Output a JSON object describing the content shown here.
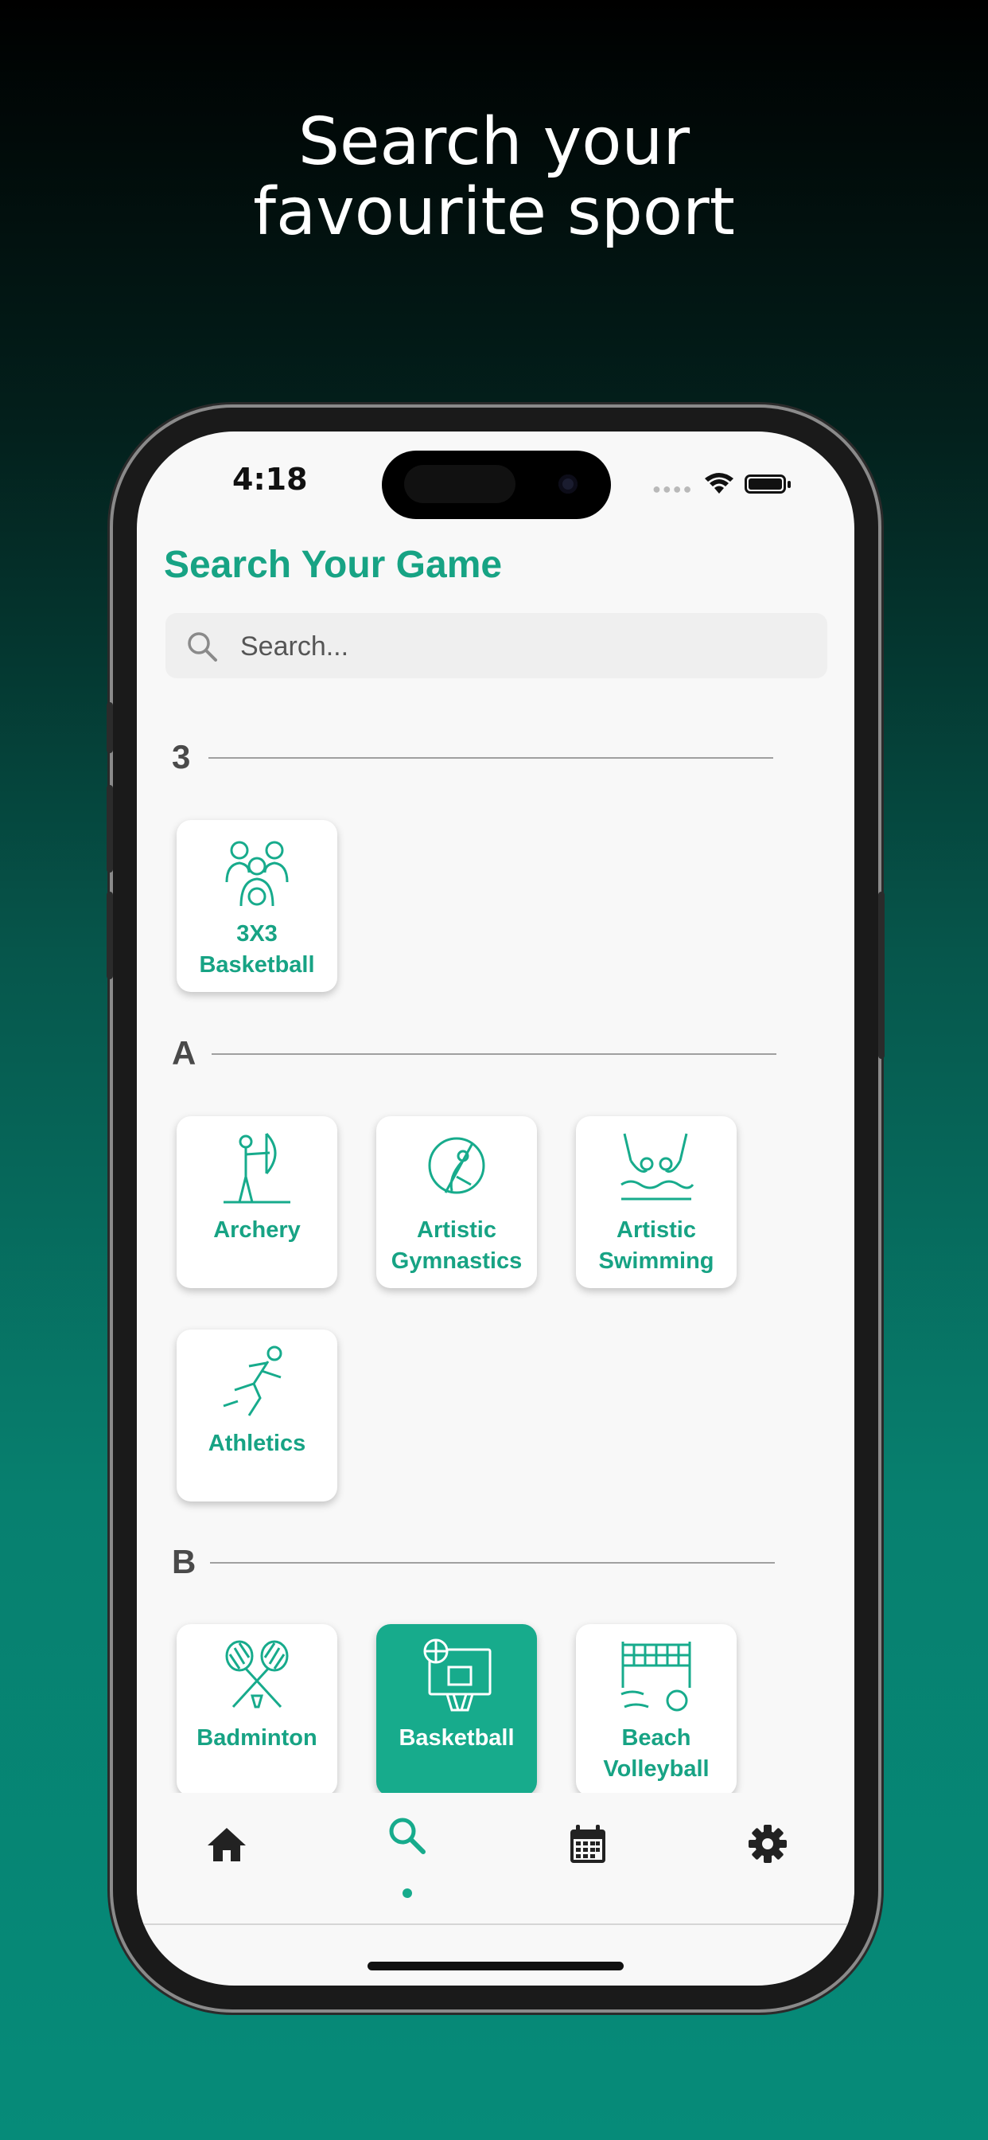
{
  "headline": {
    "line1": "Search your",
    "line2": "favourite sport"
  },
  "status_bar": {
    "time": "4:18"
  },
  "app": {
    "title": "Search Your Game"
  },
  "search": {
    "placeholder": "Search..."
  },
  "sections": [
    {
      "letter": "3",
      "items": [
        {
          "label1": "3X3",
          "label2": "Basketball"
        }
      ]
    },
    {
      "letter": "A",
      "items": [
        {
          "label1": "Archery",
          "label2": ""
        },
        {
          "label1": "Artistic",
          "label2": "Gymnastics"
        },
        {
          "label1": "Artistic",
          "label2": "Swimming"
        },
        {
          "label1": "Athletics",
          "label2": ""
        }
      ]
    },
    {
      "letter": "B",
      "items": [
        {
          "label1": "Badminton",
          "label2": ""
        },
        {
          "label1": "Basketball",
          "label2": ""
        },
        {
          "label1": "Beach",
          "label2": "Volleyball"
        }
      ]
    }
  ],
  "selected_sport": "Basketball",
  "nav": {
    "items": [
      "home-icon",
      "search-icon",
      "calendar-icon",
      "settings-icon"
    ],
    "active": "search-icon"
  },
  "colors": {
    "accent": "#17ab8c",
    "title": "#17a384",
    "background": "#f8f8f8"
  }
}
